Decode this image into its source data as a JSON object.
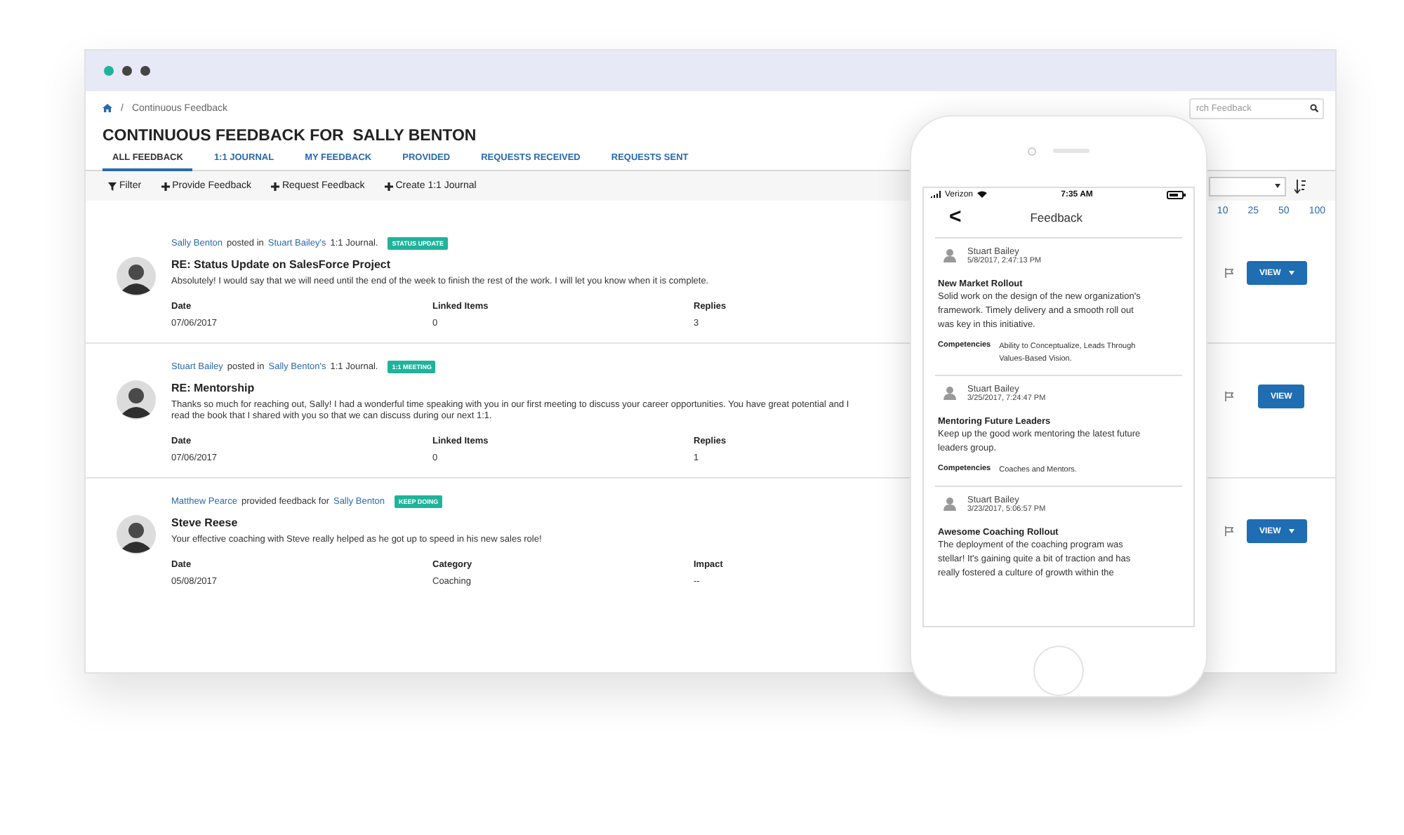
{
  "breadcrumb": {
    "current": "Continuous Feedback",
    "separator": "/"
  },
  "title": "CONTINUOUS FEEDBACK FOR  SALLY BENTON",
  "search": {
    "placeholder": "rch Feedback"
  },
  "tabs": [
    {
      "label": "ALL FEEDBACK",
      "selected": true
    },
    {
      "label": "1:1 JOURNAL",
      "selected": false
    },
    {
      "label": "MY FEEDBACK",
      "selected": false
    },
    {
      "label": "PROVIDED",
      "selected": false
    },
    {
      "label": "REQUESTS RECEIVED",
      "selected": false
    },
    {
      "label": "REQUESTS SENT",
      "selected": false
    }
  ],
  "toolbar": [
    {
      "kind": "filter",
      "label": "Filter"
    },
    {
      "kind": "add",
      "label": "Provide Feedback"
    },
    {
      "kind": "add",
      "label": "Request Feedback"
    },
    {
      "kind": "add",
      "label": "Create 1:1 Journal"
    }
  ],
  "page_sizes": [
    "10",
    "25",
    "50",
    "100"
  ],
  "cards": [
    {
      "author": "Sally Benton",
      "verb": "posted in",
      "target": "Stuart Bailey's",
      "suffix": "1:1 Journal.",
      "badge": "STATUS UPDATE",
      "title": "RE: Status Update on SalesForce Project",
      "body_lines": [
        "Absolutely!  I would say that we will need until the end of the week to finish the rest of the work. I will let you know when it is complete."
      ],
      "fields": [
        {
          "label": "Date",
          "value": "07/06/2017"
        },
        {
          "label": "Linked Items",
          "value": "0"
        },
        {
          "label": "Replies",
          "value": "3"
        }
      ],
      "view": "VIEW",
      "has_menu": true
    },
    {
      "author": "Stuart Bailey",
      "verb": "posted in",
      "target": "Sally Benton's",
      "suffix": "1:1 Journal.",
      "badge": "1:1 MEETING",
      "title": "RE: Mentorship",
      "body_lines": [
        "Thanks so much for reaching out, Sally! I had a wonderful time speaking with you in our first meeting to discuss your career opportunities. You have great potential and I",
        "read the book that I shared with you so that we can discuss during our next 1:1."
      ],
      "fields": [
        {
          "label": "Date",
          "value": "07/06/2017"
        },
        {
          "label": "Linked Items",
          "value": "0"
        },
        {
          "label": "Replies",
          "value": "1"
        }
      ],
      "view": "VIEW",
      "has_menu": false
    },
    {
      "author": "Matthew Pearce",
      "verb": "provided feedback for",
      "target": "Sally Benton",
      "badge": "KEEP DOING",
      "title": "Steve Reese",
      "body_lines": [
        "Your effective coaching with Steve really helped as he got up to speed in his new sales role!"
      ],
      "fields": [
        {
          "label": "Date",
          "value": "05/08/2017"
        },
        {
          "label": "Category",
          "value": "Coaching"
        },
        {
          "label": "Impact",
          "value": "--"
        }
      ],
      "view": "VIEW",
      "has_menu": true
    }
  ],
  "phone": {
    "carrier": "Verizon",
    "time": "7:35 AM",
    "back": "<",
    "title": "Feedback",
    "items": [
      {
        "name": "Stuart Bailey",
        "date": "5/8/2017, 2:47:13 PM",
        "title": "New Market Rollout",
        "body_lines": [
          "Solid work on the design of the new organization's",
          "framework.  Timely delivery and a smooth roll out",
          "was key in this initiative."
        ],
        "competencies_label": "Competencies",
        "competencies_lines": [
          "Ability to Conceptualize, Leads Through",
          "Values-Based Vision."
        ]
      },
      {
        "name": "Stuart Bailey",
        "date": "3/25/2017, 7:24:47 PM",
        "title": "Mentoring Future Leaders",
        "body_lines": [
          "Keep up the good work mentoring the latest future",
          "leaders group."
        ],
        "competencies_label": "Competencies",
        "competencies_lines": [
          "Coaches and Mentors."
        ]
      },
      {
        "name": "Stuart Bailey",
        "date": "3/23/2017, 5:06:57 PM",
        "title": "Awesome Coaching Rollout",
        "body_lines": [
          "The deployment of the coaching program was",
          "stellar!  It's gaining quite a bit of traction and has",
          "really fostered a culture of growth within the"
        ]
      }
    ]
  }
}
